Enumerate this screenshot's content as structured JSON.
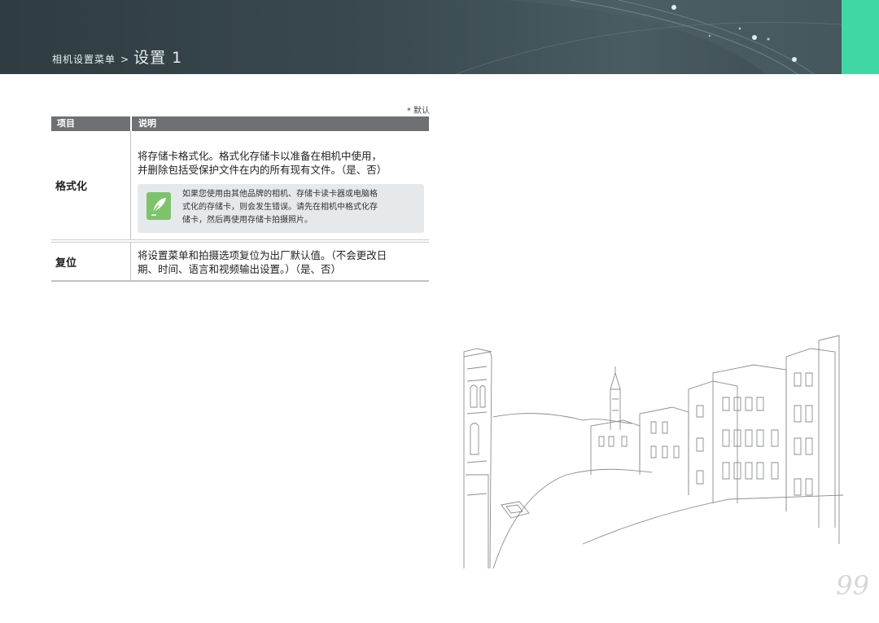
{
  "header": {
    "breadcrumb_parent": "相机设置菜单",
    "breadcrumb_separator": ">",
    "title": "设置 1",
    "accent_color": "#3fd8a5",
    "banner_color": "#3a4950"
  },
  "default_note": "* 默认",
  "table": {
    "headers": {
      "item": "项目",
      "description": "说明"
    },
    "rows": [
      {
        "item": "格式化",
        "description_line1": "将存储卡格式化。格式化存储卡以准备在相机中使用，",
        "description_line2": "并删除包括受保护文件在内的所有现有文件。（是、否）",
        "note": {
          "icon": "pen-note-icon",
          "line1": "如果您使用由其他品牌的相机、存储卡读卡器或电脑格",
          "line2": "式化的存储卡，则会发生错误。请先在相机中格式化存",
          "line3": "储卡，然后再使用存储卡拍摄照片。"
        }
      },
      {
        "item": "复位",
        "description_line1": "将设置菜单和拍摄选项复位为出厂默认值。（不会更改日",
        "description_line2": "期、时间、语言和视频输出设置。）（是、否）"
      }
    ]
  },
  "page_number": "99"
}
